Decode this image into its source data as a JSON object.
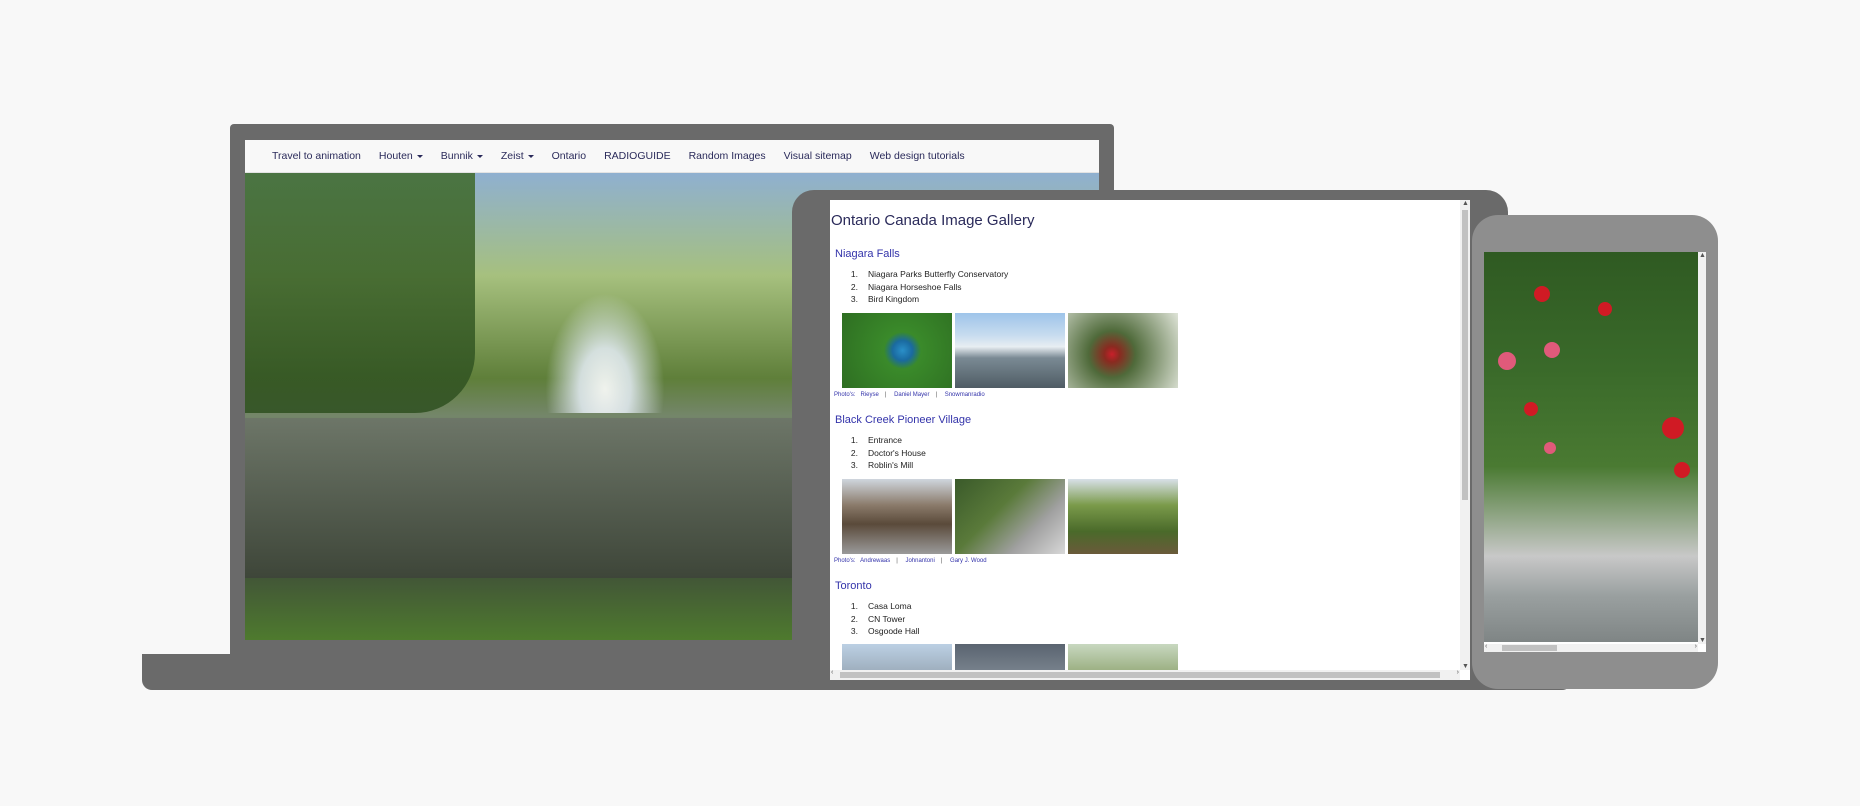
{
  "laptop": {
    "nav": [
      {
        "label": "Travel to animation",
        "dropdown": false
      },
      {
        "label": "Houten",
        "dropdown": true
      },
      {
        "label": "Bunnik",
        "dropdown": true
      },
      {
        "label": "Zeist",
        "dropdown": true
      },
      {
        "label": "Ontario",
        "dropdown": false
      },
      {
        "label": "RADIOGUIDE",
        "dropdown": false
      },
      {
        "label": "Random Images",
        "dropdown": false
      },
      {
        "label": "Visual sitemap",
        "dropdown": false
      },
      {
        "label": "Web design tutorials",
        "dropdown": false
      }
    ]
  },
  "tablet": {
    "title": "Ontario Canada Image Gallery",
    "sections": [
      {
        "title": "Niagara Falls",
        "items": [
          "Niagara Parks Butterfly Conservatory",
          "Niagara Horseshoe Falls",
          "Bird Kingdom"
        ],
        "credits_prefix": "Photo's:",
        "credits": [
          "Rieyse",
          "Daniel Mayer",
          "Snowmanradio"
        ]
      },
      {
        "title": "Black Creek Pioneer Village",
        "items": [
          "Entrance",
          "Doctor's House",
          "Roblin's Mill"
        ],
        "credits_prefix": "Photo's:",
        "credits": [
          "Andrewaas",
          "Johnantoni",
          "Gary J. Wood"
        ]
      },
      {
        "title": "Toronto",
        "items": [
          "Casa Loma",
          "CN Tower",
          "Osgoode Hall"
        ],
        "credits_prefix": "",
        "credits": []
      }
    ],
    "list_numbers": [
      "1.",
      "2.",
      "3."
    ]
  },
  "scroll_arrows": {
    "up": "▲",
    "down": "▼",
    "left": "‹",
    "right": "›"
  }
}
